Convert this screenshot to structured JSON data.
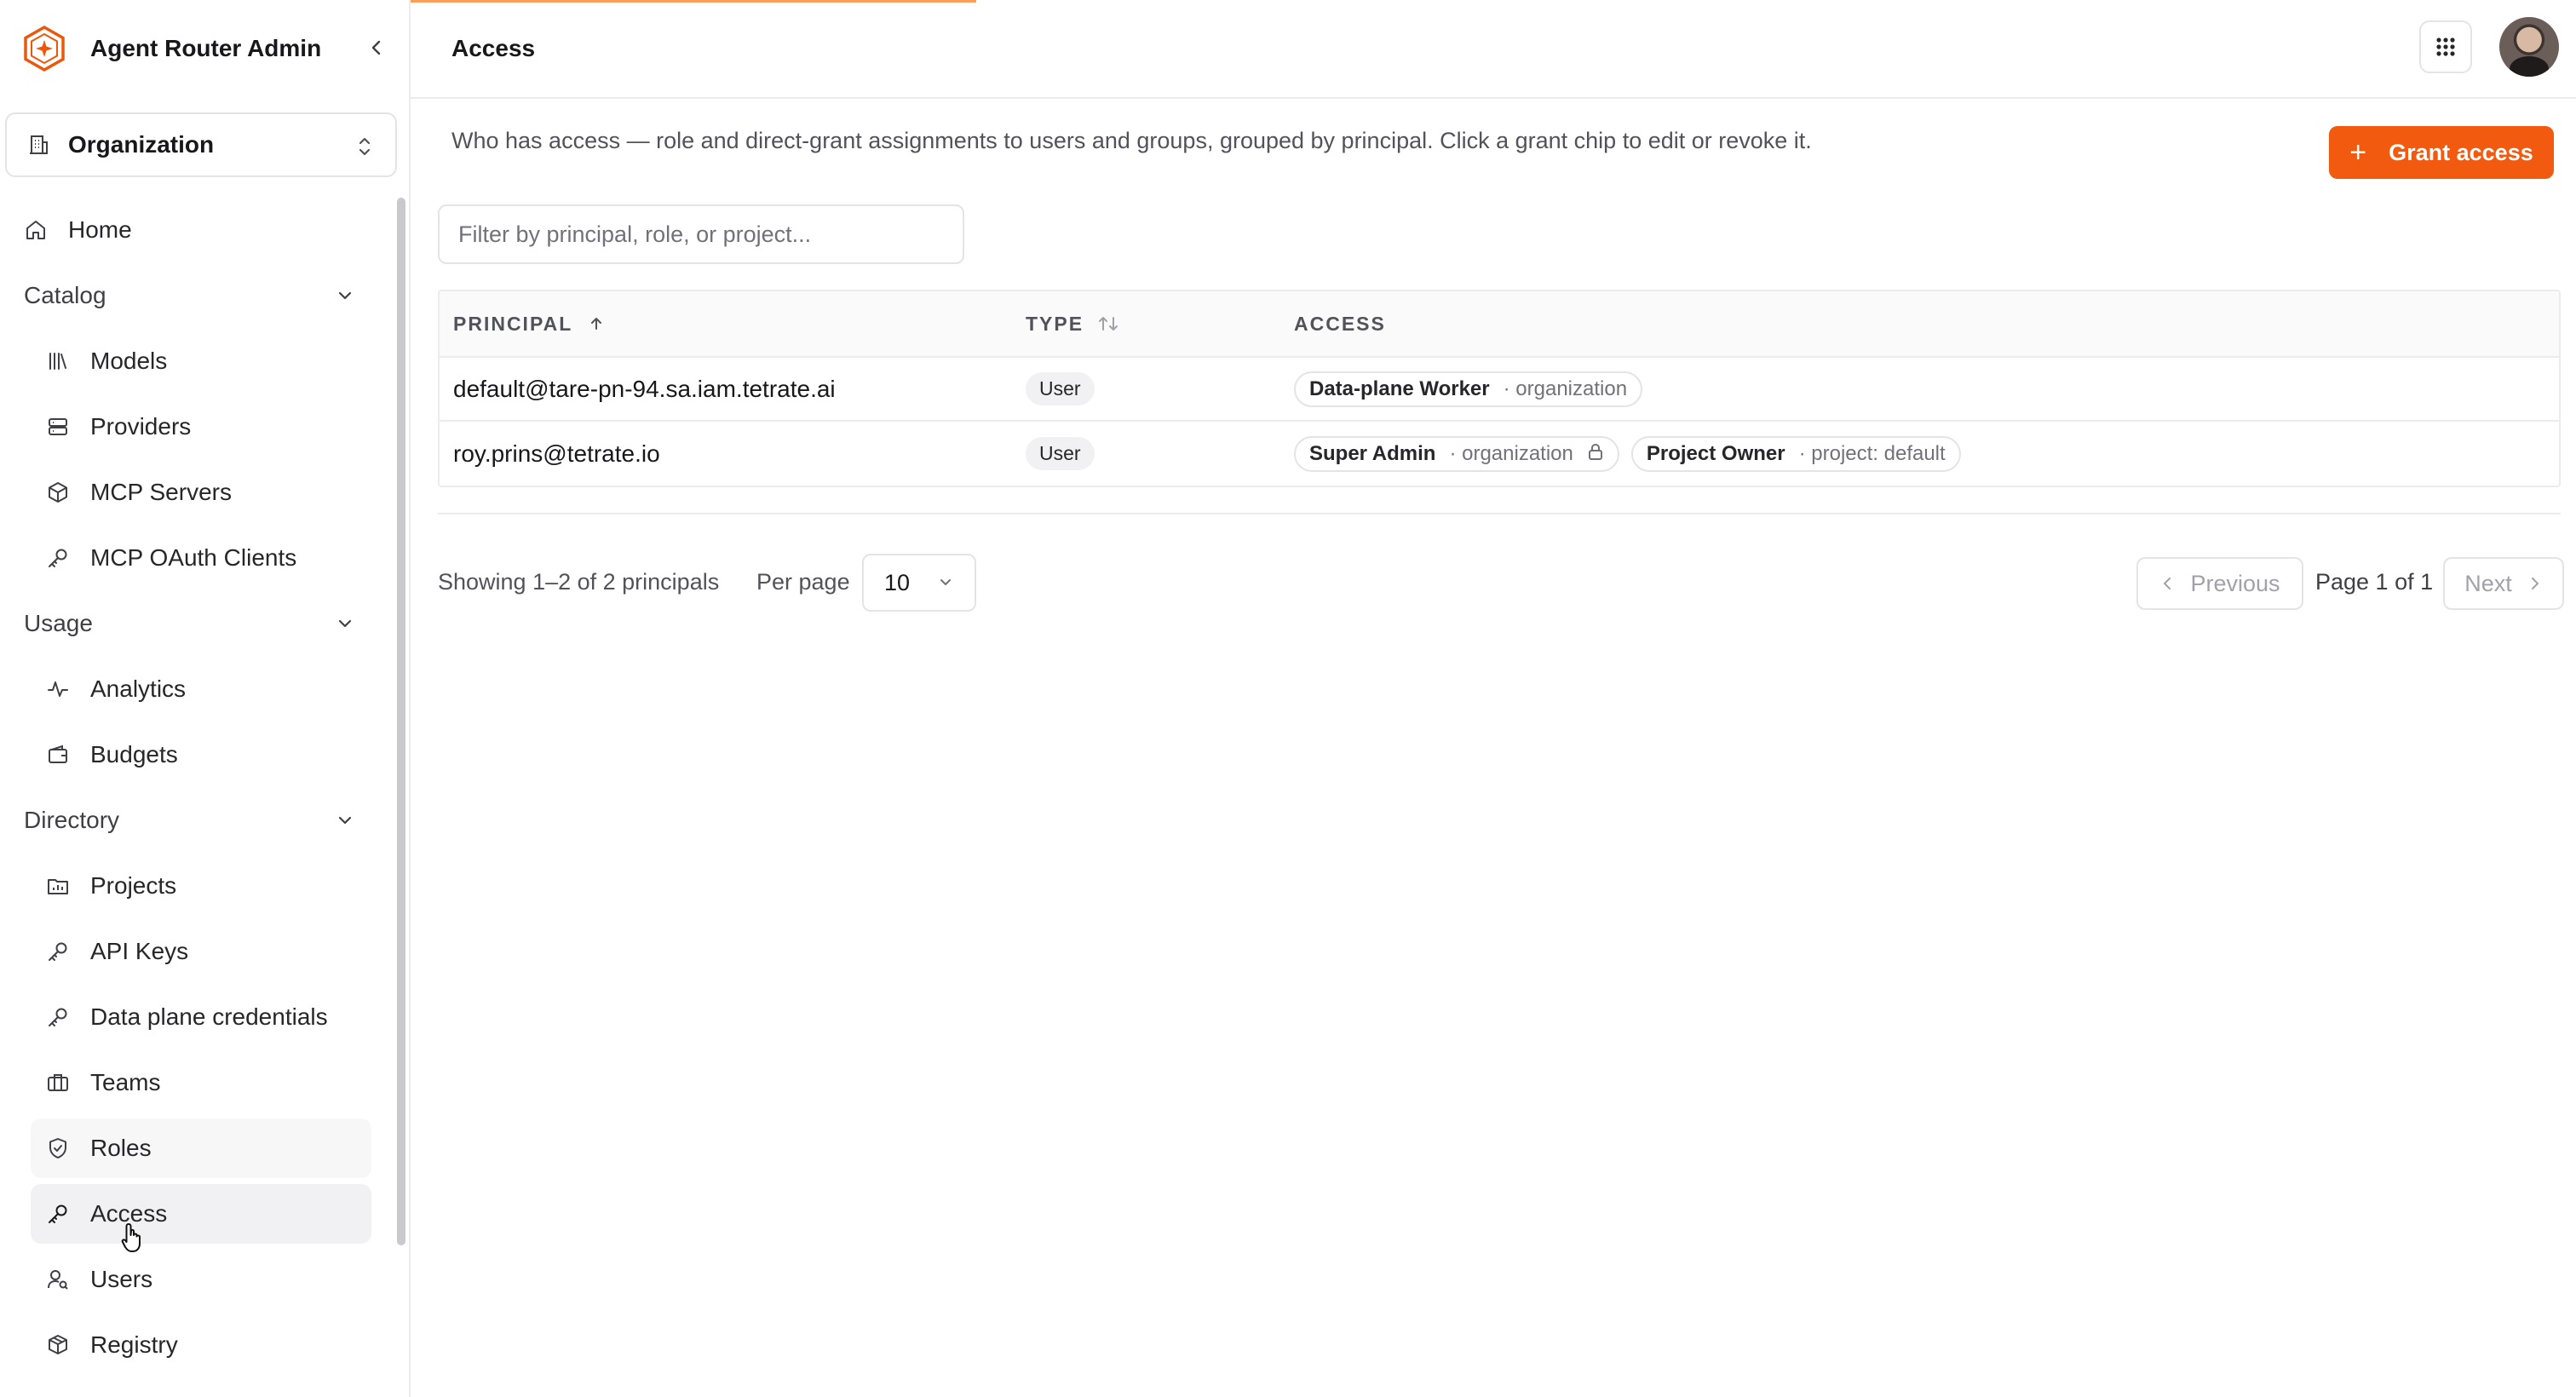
{
  "app": {
    "title": "Agent Router Admin"
  },
  "org_select": {
    "label": "Organization"
  },
  "nav": {
    "home": "Home",
    "catalog": {
      "label": "Catalog",
      "items": [
        "Models",
        "Providers",
        "MCP Servers",
        "MCP OAuth Clients"
      ]
    },
    "usage": {
      "label": "Usage",
      "items": [
        "Analytics",
        "Budgets"
      ]
    },
    "directory": {
      "label": "Directory",
      "items": [
        "Projects",
        "API Keys",
        "Data plane credentials",
        "Teams",
        "Roles",
        "Access",
        "Users",
        "Registry"
      ]
    }
  },
  "header": {
    "title": "Access"
  },
  "page": {
    "description": "Who has access — role and direct-grant assignments to users and groups, grouped by principal. Click a grant chip to edit or revoke it.",
    "grant_button": "Grant access",
    "filter_placeholder": "Filter by principal, role, or project..."
  },
  "table": {
    "columns": {
      "principal": "PRINCIPAL",
      "type": "TYPE",
      "access": "ACCESS"
    },
    "rows": [
      {
        "principal": "default@tare-pn-94.sa.iam.tetrate.ai",
        "type": "User",
        "grants": [
          {
            "role": "Data-plane Worker",
            "scope": "· organization"
          }
        ]
      },
      {
        "principal": "roy.prins@tetrate.io",
        "type": "User",
        "grants": [
          {
            "role": "Super Admin",
            "scope": "· organization"
          },
          {
            "role": "Project Owner",
            "scope": "· project: default"
          }
        ]
      }
    ]
  },
  "pagination": {
    "showing": "Showing 1–2 of 2 principals",
    "per_page_label": "Per page",
    "per_page_value": "10",
    "previous": "Previous",
    "page_info": "Page 1 of 1",
    "next": "Next"
  },
  "colors": {
    "accent": "#f15a0f",
    "active_nav_bg": "#f1f1f3"
  }
}
